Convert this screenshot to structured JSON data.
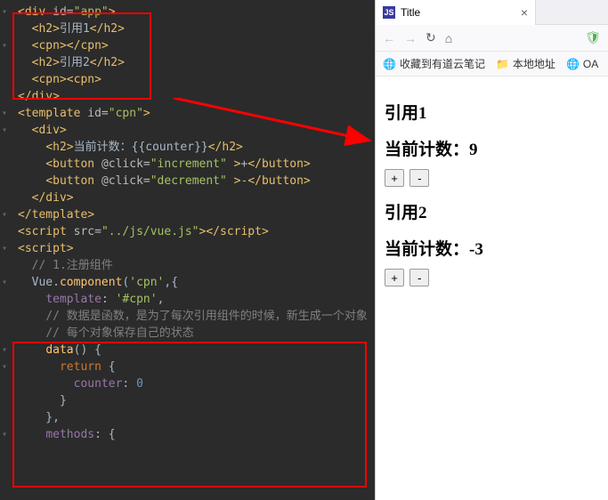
{
  "editor": {
    "lines": [
      [
        {
          "c": "tag",
          "t": "<div "
        },
        {
          "c": "attr",
          "t": "id="
        },
        {
          "c": "str",
          "t": "\"app\""
        },
        {
          "c": "tag",
          "t": ">"
        }
      ],
      [
        {
          "c": "txt",
          "t": "  "
        },
        {
          "c": "tag",
          "t": "<h2>"
        },
        {
          "c": "txt",
          "t": "引用1"
        },
        {
          "c": "tag",
          "t": "</h2>"
        }
      ],
      [
        {
          "c": "txt",
          "t": "  "
        },
        {
          "c": "tag",
          "t": "<cpn></cpn>"
        }
      ],
      [
        {
          "c": "txt",
          "t": "  "
        },
        {
          "c": "tag",
          "t": "<h2>"
        },
        {
          "c": "txt",
          "t": "引用2"
        },
        {
          "c": "tag",
          "t": "</h2>"
        }
      ],
      [
        {
          "c": "txt",
          "t": "  "
        },
        {
          "c": "tag",
          "t": "<cpn><cpn>"
        }
      ],
      [
        {
          "c": "tag",
          "t": "</div>"
        }
      ],
      [
        {
          "c": "txt",
          "t": ""
        }
      ],
      [
        {
          "c": "tag",
          "t": "<template "
        },
        {
          "c": "attr",
          "t": "id="
        },
        {
          "c": "str",
          "t": "\"cpn\""
        },
        {
          "c": "tag",
          "t": ">"
        }
      ],
      [
        {
          "c": "txt",
          "t": "  "
        },
        {
          "c": "tag",
          "t": "<div>"
        }
      ],
      [
        {
          "c": "txt",
          "t": "    "
        },
        {
          "c": "tag",
          "t": "<h2>"
        },
        {
          "c": "txt",
          "t": "当前计数：{{counter}}"
        },
        {
          "c": "tag",
          "t": "</h2>"
        }
      ],
      [
        {
          "c": "txt",
          "t": "    "
        },
        {
          "c": "tag",
          "t": "<button "
        },
        {
          "c": "attr",
          "t": "@click="
        },
        {
          "c": "str",
          "t": "\"increment\""
        },
        {
          "c": "tag",
          "t": " >"
        },
        {
          "c": "txt",
          "t": "+"
        },
        {
          "c": "tag",
          "t": "</button>"
        }
      ],
      [
        {
          "c": "txt",
          "t": "    "
        },
        {
          "c": "tag",
          "t": "<button "
        },
        {
          "c": "attr",
          "t": "@click="
        },
        {
          "c": "str",
          "t": "\"decrement\""
        },
        {
          "c": "tag",
          "t": " >"
        },
        {
          "c": "txt",
          "t": "-"
        },
        {
          "c": "tag",
          "t": "</button>"
        }
      ],
      [
        {
          "c": "txt",
          "t": "  "
        },
        {
          "c": "tag",
          "t": "</div>"
        }
      ],
      [
        {
          "c": "tag",
          "t": "</template>"
        }
      ],
      [
        {
          "c": "txt",
          "t": ""
        }
      ],
      [
        {
          "c": "tag",
          "t": "<script "
        },
        {
          "c": "attr",
          "t": "src="
        },
        {
          "c": "str",
          "t": "\"../js/vue.js\""
        },
        {
          "c": "tag",
          "t": "></"
        },
        {
          "c": "tag",
          "t": "script>"
        }
      ],
      [
        {
          "c": "tag",
          "t": "<script>"
        }
      ],
      [
        {
          "c": "txt",
          "t": "  "
        },
        {
          "c": "comment",
          "t": "// 1.注册组件"
        }
      ],
      [
        {
          "c": "txt",
          "t": "  Vue."
        },
        {
          "c": "fn",
          "t": "component"
        },
        {
          "c": "txt",
          "t": "("
        },
        {
          "c": "str",
          "t": "'cpn'"
        },
        {
          "c": "txt",
          "t": ",{"
        }
      ],
      [
        {
          "c": "txt",
          "t": "    "
        },
        {
          "c": "prop",
          "t": "template"
        },
        {
          "c": "txt",
          "t": ": "
        },
        {
          "c": "str",
          "t": "'#cpn'"
        },
        {
          "c": "txt",
          "t": ","
        }
      ],
      [
        {
          "c": "txt",
          "t": "    "
        },
        {
          "c": "comment",
          "t": "// 数据是函数，是为了每次引用组件的时候，新生成一个对象"
        }
      ],
      [
        {
          "c": "txt",
          "t": "    "
        },
        {
          "c": "comment",
          "t": "// 每个对象保存自己的状态"
        }
      ],
      [
        {
          "c": "txt",
          "t": "    "
        },
        {
          "c": "fn",
          "t": "data"
        },
        {
          "c": "txt",
          "t": "() {"
        }
      ],
      [
        {
          "c": "txt",
          "t": "      "
        },
        {
          "c": "kw",
          "t": "return"
        },
        {
          "c": "txt",
          "t": " {"
        }
      ],
      [
        {
          "c": "txt",
          "t": "        "
        },
        {
          "c": "prop",
          "t": "counter"
        },
        {
          "c": "txt",
          "t": ": "
        },
        {
          "c": "num",
          "t": "0"
        }
      ],
      [
        {
          "c": "txt",
          "t": "      }"
        }
      ],
      [
        {
          "c": "txt",
          "t": "    },"
        }
      ],
      [
        {
          "c": "txt",
          "t": "    "
        },
        {
          "c": "prop",
          "t": "methods"
        },
        {
          "c": "txt",
          "t": ": {"
        }
      ]
    ],
    "folds": [
      0,
      2,
      7,
      8,
      13,
      16,
      18,
      22,
      23,
      27
    ]
  },
  "browser": {
    "tab_title": "Title",
    "bookmarks": {
      "b1": "收藏到有道云笔记",
      "b2": "本地地址",
      "b3": "OA"
    },
    "page": {
      "ref1_title": "引用1",
      "counter1_label": "当前计数：9",
      "ref2_title": "引用2",
      "counter2_label": "当前计数：-3",
      "btn_plus": "+",
      "btn_minus": "-"
    }
  }
}
